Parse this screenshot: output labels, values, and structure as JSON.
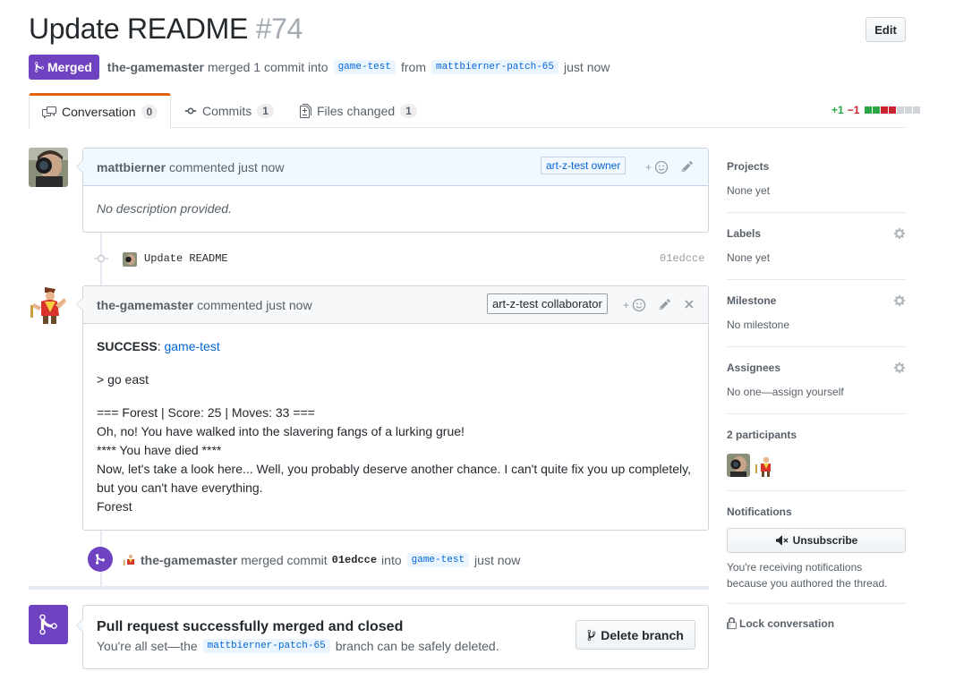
{
  "pr": {
    "title": "Update README",
    "number": "#74",
    "state": "Merged",
    "author": "the-gamemaster",
    "action_text": "merged 1 commit into",
    "base_branch": "game-test",
    "from_text": "from",
    "head_branch": "mattbierner-patch-65",
    "time": "just now"
  },
  "header": {
    "edit_label": "Edit"
  },
  "tabs": [
    {
      "label": "Conversation",
      "count": "0"
    },
    {
      "label": "Commits",
      "count": "1"
    },
    {
      "label": "Files changed",
      "count": "1"
    }
  ],
  "diffstat": {
    "additions": "+1",
    "deletions": "−1",
    "blocks": [
      "#28a745",
      "#28a745",
      "#cb2431",
      "#cb2431",
      "#d1d5da",
      "#d1d5da",
      "#d1d5da"
    ]
  },
  "comments": [
    {
      "author": "mattbierner",
      "action": "commented just now",
      "role": "art-z-test owner",
      "body": "No description provided."
    },
    {
      "author": "the-gamemaster",
      "action": "commented just now",
      "role": "art-z-test collaborator",
      "success_label": "SUCCESS",
      "success_sep": ":",
      "success_link": "game-test",
      "command": "> go east",
      "lines": [
        "=== Forest | Score: 25 | Moves: 33 ===",
        "Oh, no! You have walked into the slavering fangs of a lurking grue!",
        "**** You have died ****",
        "Now, let's take a look here... Well, you probably deserve another chance. I can't quite fix you up completely, but you can't have everything.",
        "Forest"
      ]
    }
  ],
  "commit": {
    "message": "Update README",
    "sha": "01edcce"
  },
  "merge_event": {
    "author": "the-gamemaster",
    "text1": "merged commit",
    "sha": "01edcce",
    "text2": "into",
    "branch": "game-test",
    "time": "just now"
  },
  "merge_box": {
    "title": "Pull request successfully merged and closed",
    "text1": "You're all set—the",
    "branch": "mattbierner-patch-65",
    "text2": "branch can be safely deleted.",
    "delete_label": "Delete branch"
  },
  "sidebar": {
    "projects": {
      "title": "Projects",
      "value": "None yet"
    },
    "labels": {
      "title": "Labels",
      "value": "None yet"
    },
    "milestone": {
      "title": "Milestone",
      "value": "No milestone"
    },
    "assignees": {
      "title": "Assignees",
      "value": "No one—assign yourself"
    },
    "participants": {
      "title": "2 participants"
    },
    "notifications": {
      "title": "Notifications",
      "button": "Unsubscribe",
      "reason_line1": "You're receiving notifications",
      "reason_line2": "because you authored the thread."
    },
    "lock": "Lock conversation"
  },
  "colors": {
    "merged": "#6f42c1",
    "link": "#0366d6",
    "tab_accent": "#e36209"
  }
}
